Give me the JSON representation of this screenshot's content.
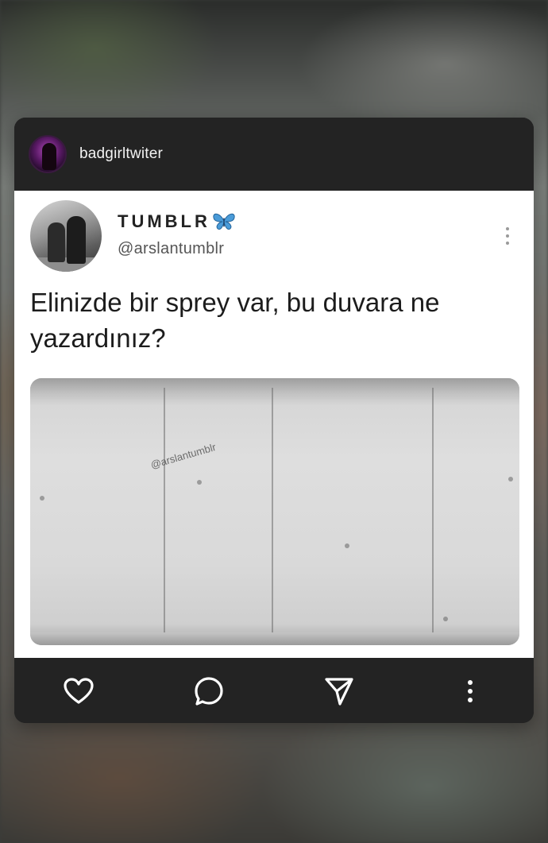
{
  "post": {
    "username": "badgirltwiter"
  },
  "tweet": {
    "display_name": "TUMBLR",
    "handle": "@arslantumblr",
    "text": "Elinizde bir sprey var, bu duvara ne yazardınız?",
    "image_watermark": "@arslantumblr"
  },
  "icons": {
    "avatar": "avatar-image",
    "butterfly": "butterfly-emoji",
    "tweet_more": "more-vertical-icon",
    "like": "heart-icon",
    "comment": "comment-bubble-icon",
    "share": "send-icon",
    "post_more": "more-vertical-icon"
  },
  "colors": {
    "bar_background": "#232323",
    "content_background": "#ffffff",
    "butterfly": "#4a9bd8"
  }
}
